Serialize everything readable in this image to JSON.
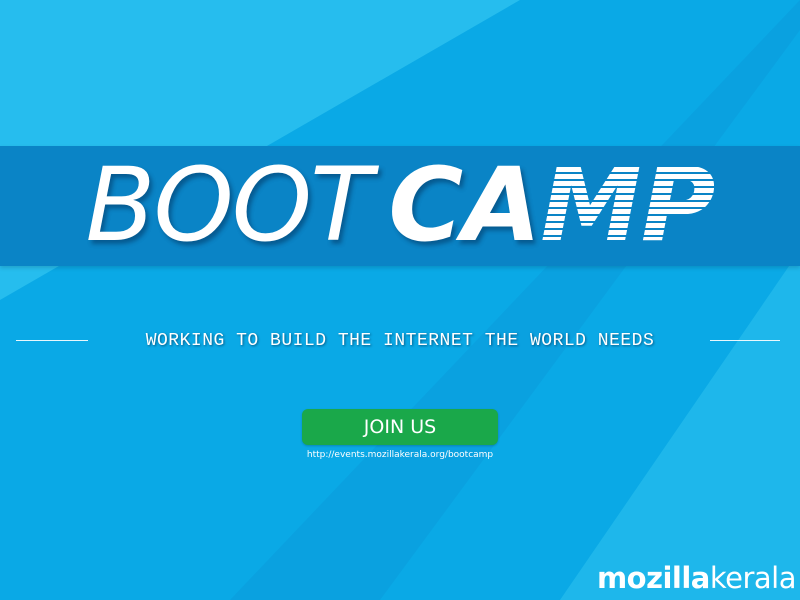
{
  "colors": {
    "background": "#0aa9e6",
    "background_light": "#2cc1ef",
    "background_dark": "#0b9bda",
    "banner": "#0a84c6",
    "button": "#1aa84a",
    "text": "#ffffff"
  },
  "headline": {
    "word1": "BOOT",
    "word2_part1": "CA",
    "word2_part2": "MP"
  },
  "tagline": "WORKING TO BUILD THE INTERNET THE WORLD NEEDS",
  "cta": {
    "label": "JOIN US",
    "url": "http://events.mozillakerala.org/bootcamp"
  },
  "logo": {
    "part1": "mozilla",
    "part2": "kerala"
  }
}
